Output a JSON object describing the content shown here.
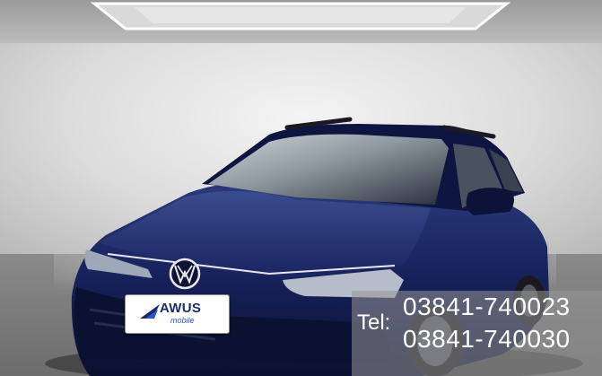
{
  "dealer_plate": {
    "brand": "AWUS",
    "subtitle": "mobile"
  },
  "contact": {
    "label": "Tel:",
    "phones": [
      "03841-740023",
      "03841-740030"
    ]
  },
  "colors": {
    "car_body": "#141e4a",
    "plate_text": "#1b2a6b",
    "overlay_text": "#ffffff"
  },
  "icons": {
    "logo": "vw-logo-icon",
    "plate_mark": "awus-arrow-icon"
  }
}
